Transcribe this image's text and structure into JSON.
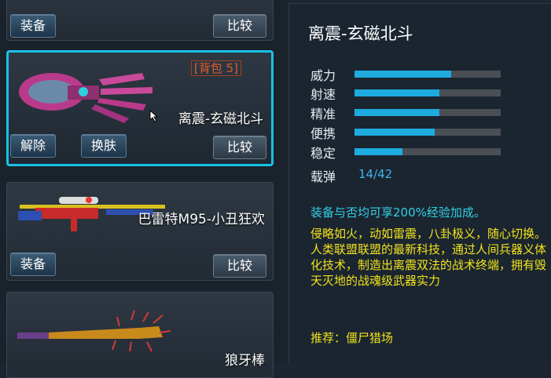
{
  "inventory": {
    "card_top": {
      "equip_label": "装备",
      "compare_label": "比较"
    },
    "card_selected": {
      "bag_badge": "[背包 5]",
      "name": "离震-玄磁北斗",
      "remove_label": "解除",
      "skin_label": "换肤",
      "compare_label": "比较"
    },
    "card_barrett": {
      "name": "巴雷特M95-小丑狂欢",
      "equip_label": "装备",
      "compare_label": "比较"
    },
    "card_bat": {
      "name": "狼牙棒"
    }
  },
  "detail": {
    "title": "离震-玄磁北斗",
    "stats": [
      {
        "label": "威力",
        "value": 0.66
      },
      {
        "label": "射速",
        "value": 0.58
      },
      {
        "label": "精准",
        "value": 0.58
      },
      {
        "label": "便携",
        "value": 0.55
      },
      {
        "label": "稳定",
        "value": 0.33
      }
    ],
    "ammo_label": "载弹",
    "ammo_value": "14/42",
    "bonus": "装备与否均可享200%经验加成。",
    "description": "侵略如火，动如雷震，八卦极义，随心切换。人类联盟联盟的最新科技，通过人间兵器义体化技术，制造出离震双法的战术终端，拥有毁天灭地的战魂级武器实力",
    "recommend": "推荐：僵尸猎场"
  },
  "colors": {
    "accent": "#19c2e6",
    "stat_fill": "#1dabe0",
    "desc": "#f2e21c",
    "bonus": "#35d0e6"
  }
}
